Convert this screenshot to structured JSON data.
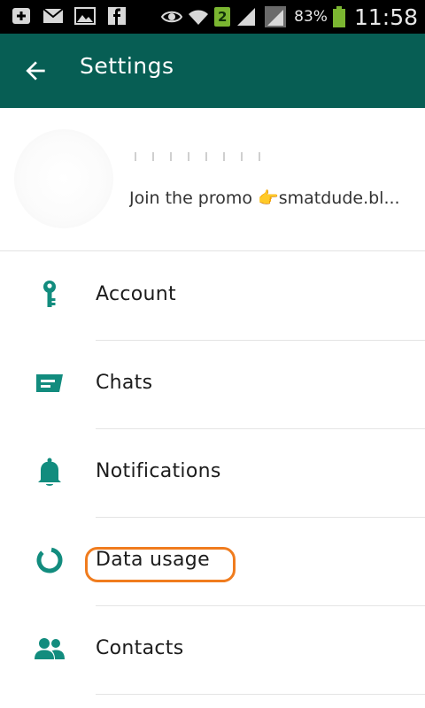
{
  "status_bar": {
    "sim_badge": "2",
    "battery_percent": "83%",
    "time": "11:58"
  },
  "app_bar": {
    "title": "Settings"
  },
  "profile": {
    "status": "Join the promo 👉smatdude.bl..."
  },
  "settings": {
    "items": [
      {
        "label": "Account",
        "icon": "key-icon"
      },
      {
        "label": "Chats",
        "icon": "chat-icon"
      },
      {
        "label": "Notifications",
        "icon": "bell-icon"
      },
      {
        "label": "Data usage",
        "icon": "data-usage-icon"
      },
      {
        "label": "Contacts",
        "icon": "contacts-icon"
      }
    ]
  },
  "colors": {
    "app_bar": "#075e54",
    "icon_accent": "#128c7e",
    "highlight": "#f07c1e"
  }
}
